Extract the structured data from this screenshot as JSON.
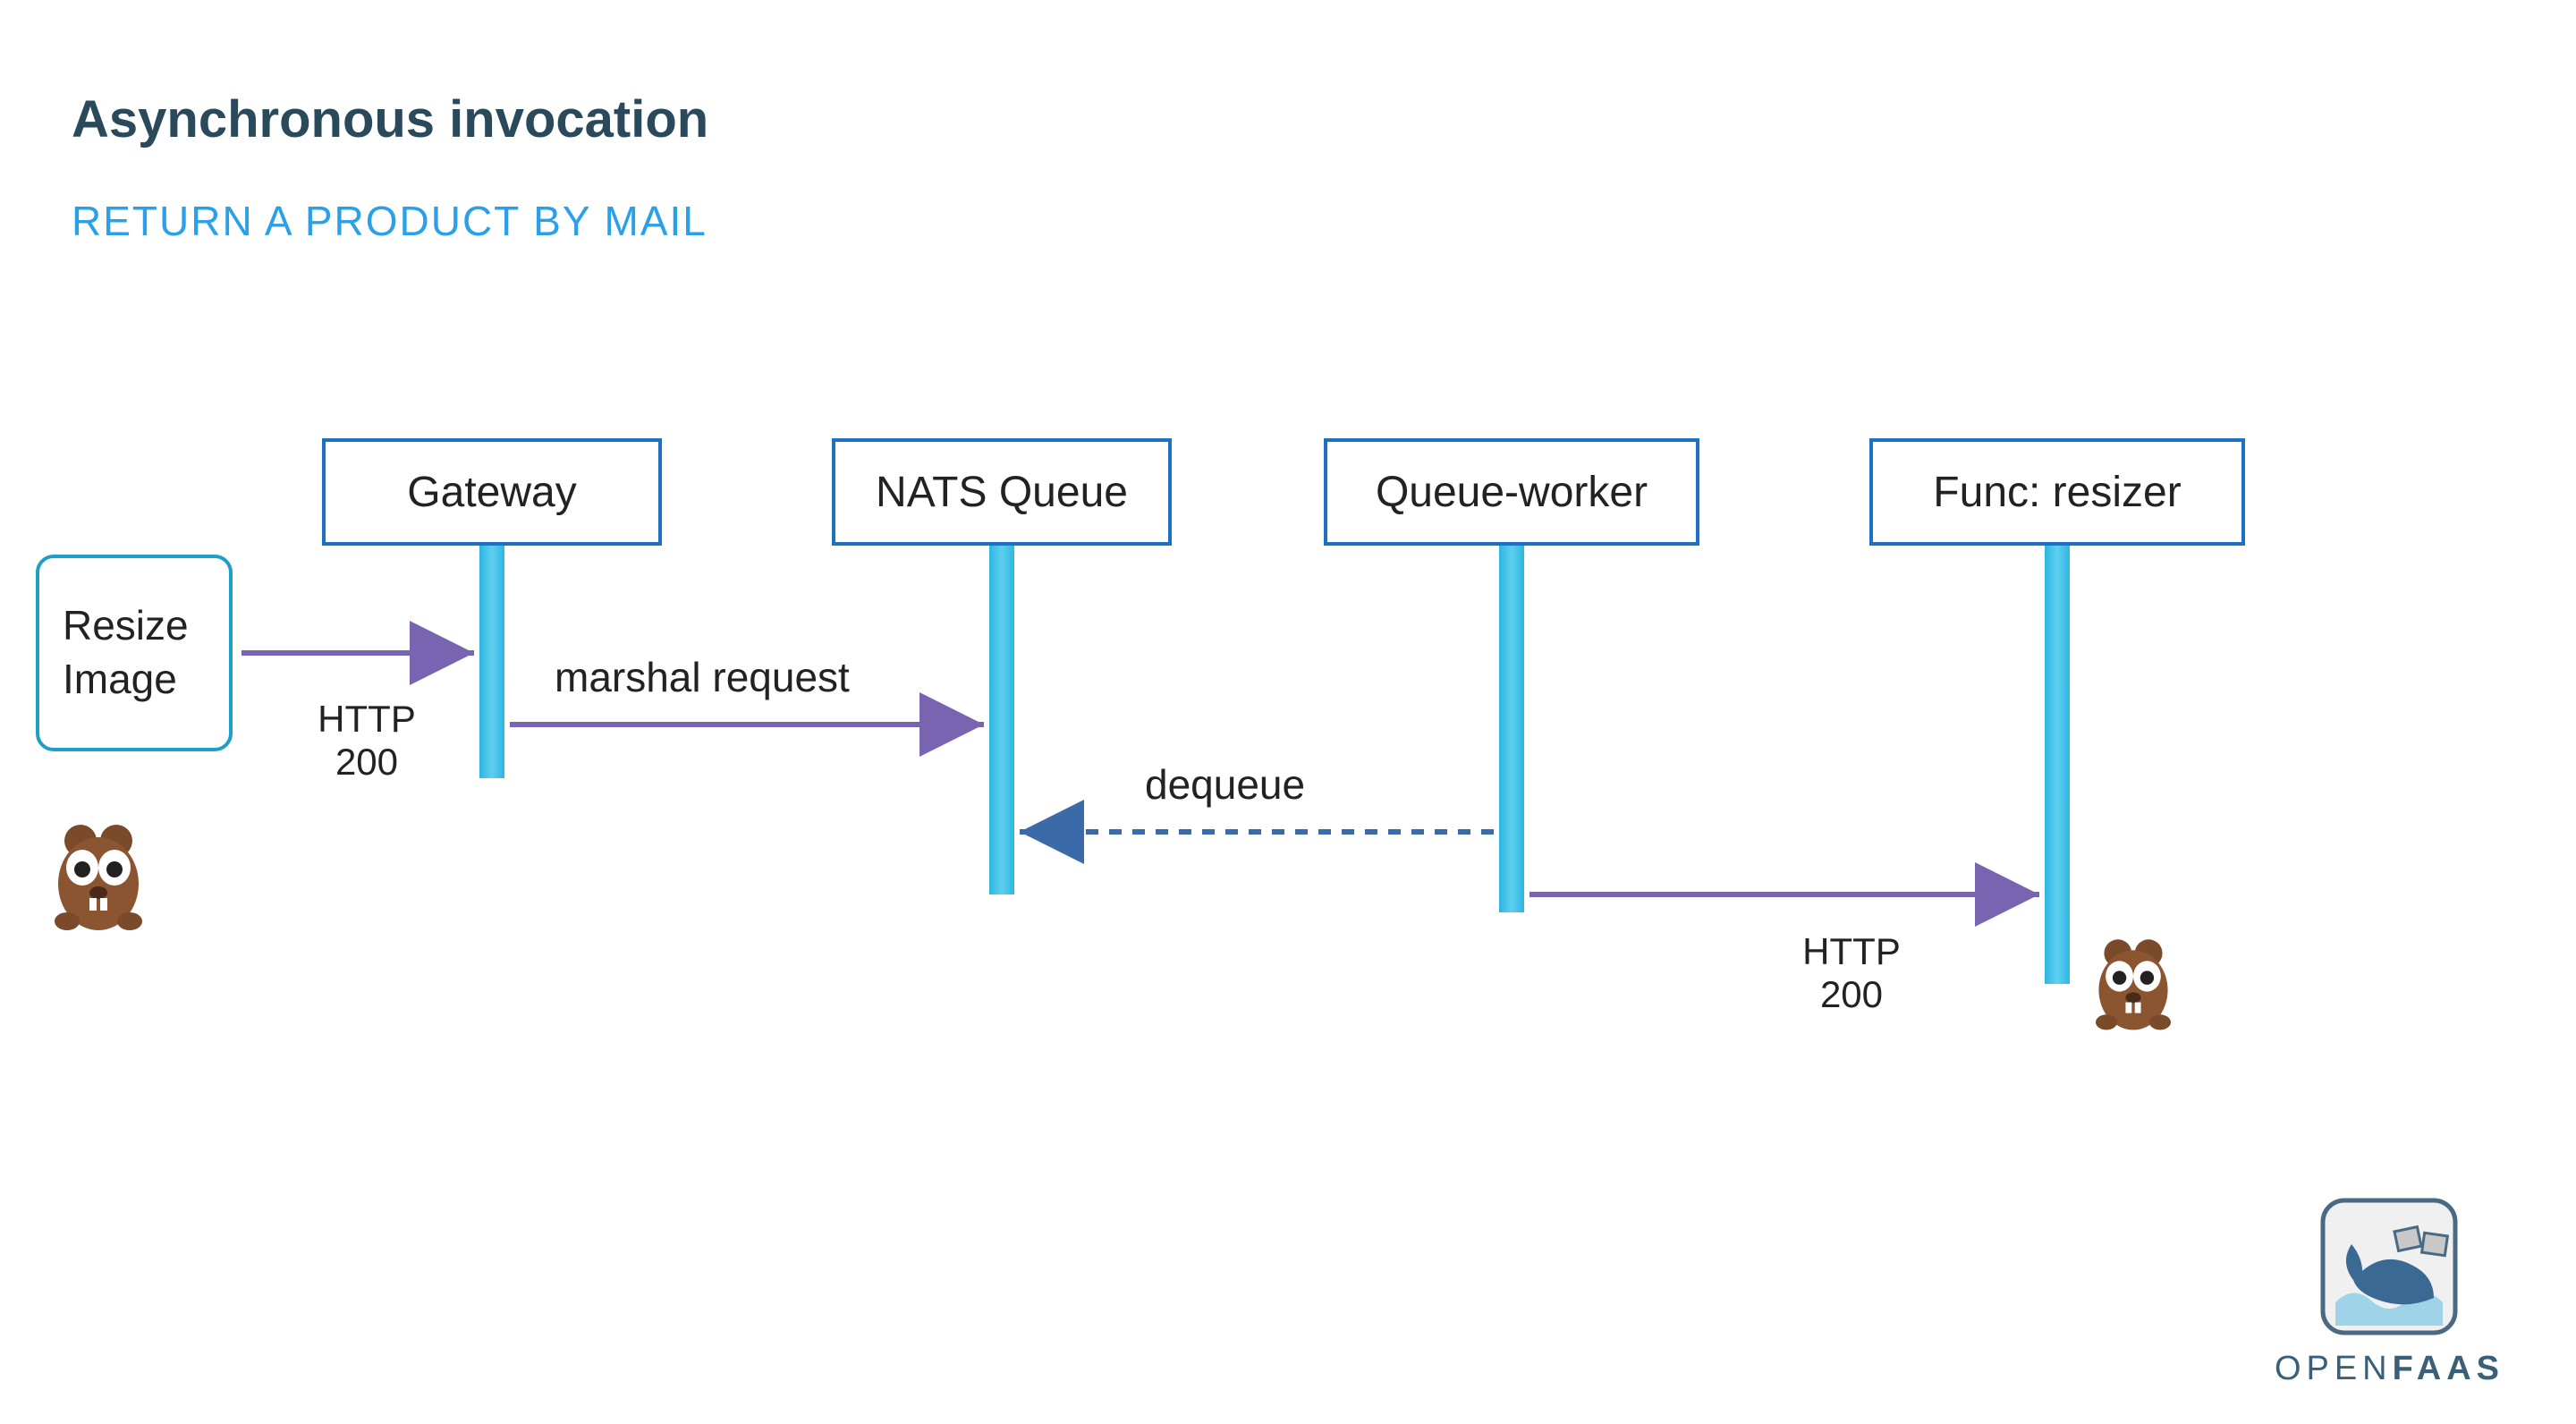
{
  "title": "Asynchronous invocation",
  "subtitle": "RETURN A PRODUCT BY MAIL",
  "actor": {
    "line1": "Resize",
    "line2": "Image"
  },
  "boxes": {
    "gateway": "Gateway",
    "nats": "NATS Queue",
    "worker": "Queue-worker",
    "func": "Func: resizer"
  },
  "labels": {
    "http200_left": "HTTP\n200",
    "marshal": "marshal request",
    "dequeue": "dequeue",
    "http200_right": "HTTP\n200"
  },
  "logo": {
    "open": "OPEN",
    "faas": "FAAS"
  }
}
